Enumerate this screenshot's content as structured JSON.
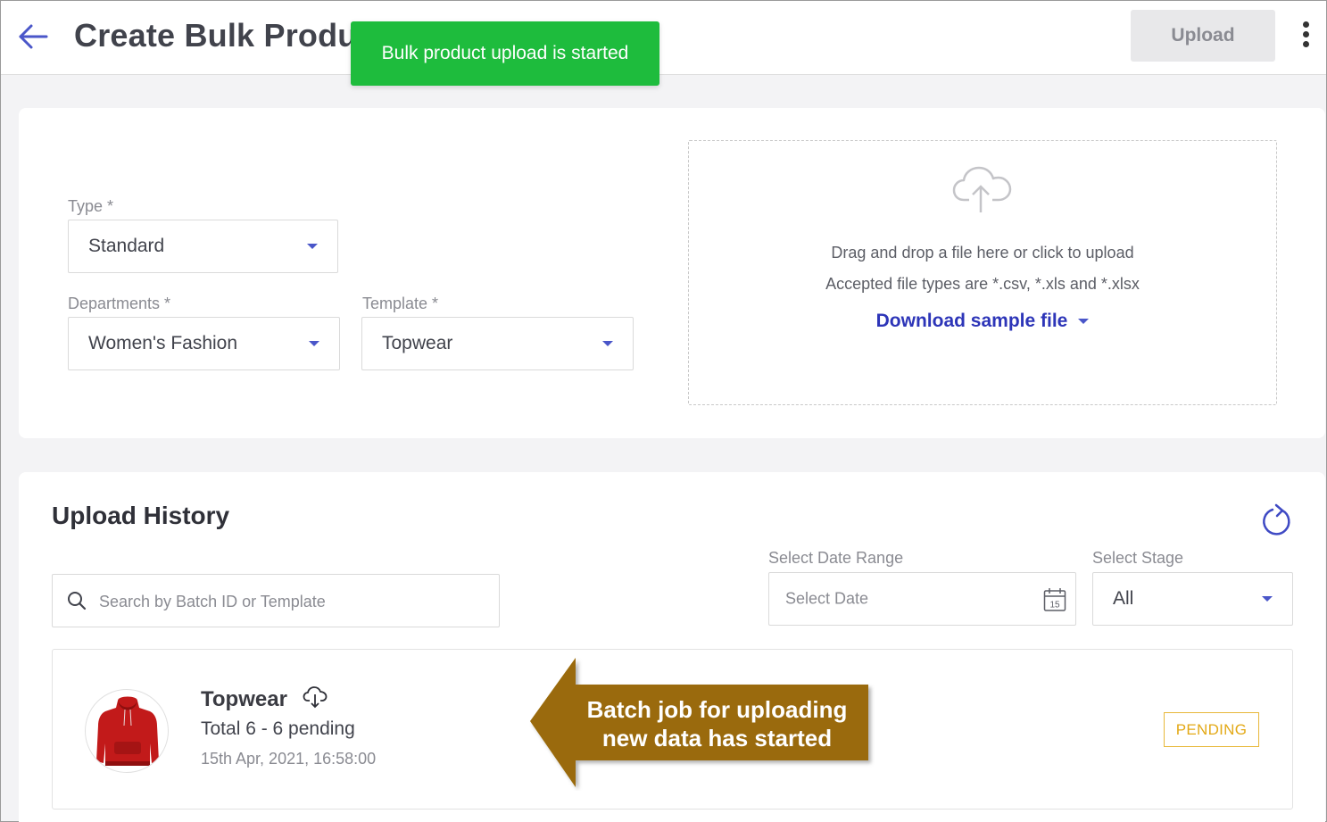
{
  "header": {
    "title": "Create Bulk Produ",
    "upload_label": "Upload"
  },
  "toast": {
    "message": "Bulk product upload is started",
    "color": "#1ebc3d"
  },
  "form": {
    "type": {
      "label": "Type *",
      "value": "Standard"
    },
    "departments": {
      "label": "Departments *",
      "value": "Women's Fashion"
    },
    "template": {
      "label": "Template *",
      "value": "Topwear"
    }
  },
  "dropzone": {
    "icon": "cloud-upload-icon",
    "line1": "Drag and drop a file here or click to upload",
    "line2": "Accepted file types are *.csv, *.xls and *.xlsx",
    "download_label": "Download sample file"
  },
  "history": {
    "title": "Upload History",
    "search_placeholder": "Search by Batch ID or Template",
    "date_range_label": "Select Date Range",
    "date_placeholder": "Select Date",
    "calendar_day": "15",
    "stage_label": "Select Stage",
    "stage_value": "All",
    "batches": [
      {
        "name": "Topwear",
        "total": "Total 6 - 6 pending",
        "date": "15th Apr, 2021, 16:58:00",
        "status": "PENDING",
        "status_color": "#e3a916"
      }
    ]
  },
  "annotation": {
    "line1": "Batch job for uploading",
    "line2": "new data has started",
    "color": "#9a6a07"
  },
  "colors": {
    "accent": "#4a56c9",
    "link": "#2d35b8"
  }
}
